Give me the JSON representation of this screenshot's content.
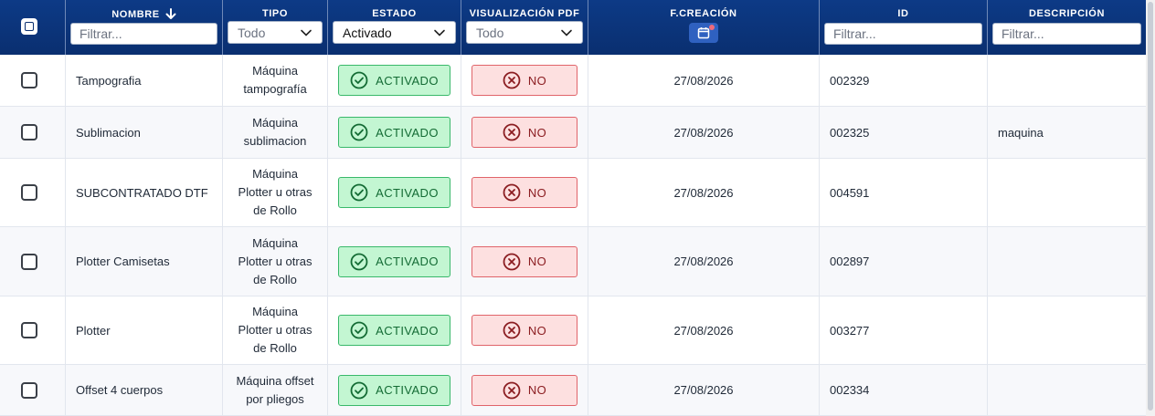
{
  "header": {
    "nombre": {
      "label": "NOMBRE",
      "placeholder": "Filtrar..."
    },
    "tipo": {
      "label": "TIPO",
      "selected": "Todo"
    },
    "estado": {
      "label": "ESTADO",
      "selected": "Activado"
    },
    "pdf": {
      "label": "VISUALIZACIÓN PDF",
      "selected": "Todo"
    },
    "fecha": {
      "label": "F.CREACIÓN"
    },
    "id": {
      "label": "ID",
      "placeholder": "Filtrar..."
    },
    "descripcion": {
      "label": "DESCRIPCIÓN",
      "placeholder": "Filtrar..."
    }
  },
  "rows": [
    {
      "nombre": "Tampografia",
      "tipo": [
        "Máquina",
        "tampografía"
      ],
      "estado": "ACTIVADO",
      "pdf": "NO",
      "fecha": "27/08/2026",
      "id": "002329",
      "descripcion": ""
    },
    {
      "nombre": "Sublimacion",
      "tipo": [
        "Máquina",
        "sublimacion"
      ],
      "estado": "ACTIVADO",
      "pdf": "NO",
      "fecha": "27/08/2026",
      "id": "002325",
      "descripcion": "maquina"
    },
    {
      "nombre": "SUBCONTRATADO DTF",
      "tipo": [
        "Máquina",
        "Plotter u otras",
        "de Rollo"
      ],
      "estado": "ACTIVADO",
      "pdf": "NO",
      "fecha": "27/08/2026",
      "id": "004591",
      "descripcion": ""
    },
    {
      "nombre": "Plotter Camisetas",
      "tipo": [
        "Máquina",
        "Plotter u otras",
        "de Rollo"
      ],
      "estado": "ACTIVADO",
      "pdf": "NO",
      "fecha": "27/08/2026",
      "id": "002897",
      "descripcion": ""
    },
    {
      "nombre": "Plotter",
      "tipo": [
        "Máquina",
        "Plotter u otras",
        "de Rollo"
      ],
      "estado": "ACTIVADO",
      "pdf": "NO",
      "fecha": "27/08/2026",
      "id": "003277",
      "descripcion": ""
    },
    {
      "nombre": "Offset 4 cuerpos",
      "tipo": [
        "Máquina offset",
        "por pliegos"
      ],
      "estado": "ACTIVADO",
      "pdf": "NO",
      "fecha": "27/08/2026",
      "id": "002334",
      "descripcion": ""
    }
  ],
  "icons": {
    "sort": "arrow-down-icon",
    "select": "chevron-down-icon",
    "calendar": "calendar-icon",
    "activado": "check-circle-icon",
    "no": "x-circle-icon"
  },
  "colors": {
    "header_bg": "#0a2f70",
    "activado_bg": "#c3f6d2",
    "activado_border": "#39b86a",
    "no_bg": "#fde0e0",
    "no_border": "#e0646a",
    "calendar_btn": "#2f61c0"
  }
}
